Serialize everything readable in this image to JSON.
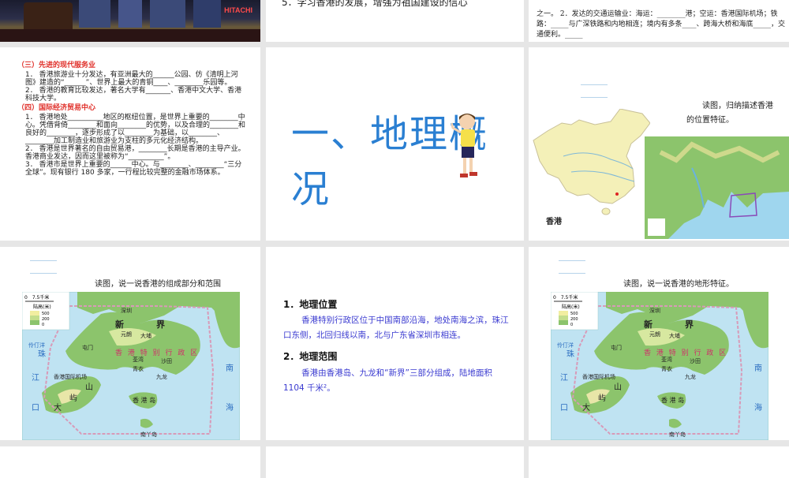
{
  "slide1": {
    "photo_sign": "HITACHI"
  },
  "slide2": {
    "text": "5．学习香港的发展，增强为祖国建设的信心"
  },
  "slide3": {
    "text": "之一。 2．发达的交通运输业：海运：________港；空运：香港国际机场；铁路：_____与广深铁路和内地相连；境内有多条____、跨海大桥和海底_____，交通便利。_____"
  },
  "slide4": {
    "h1": "（三）先进的现代服务业",
    "p1": "1． 香港旅游业十分发达，有亚洲最大的______公园、仿《清明上河图》建造的“______”、世界上最大的青铜____、________乐园等。",
    "p2": "2． 香港的教育比较发达，著名大学有_______、香港中文大学、香港科技大学。",
    "h2": "（四）国际经济贸易中心",
    "p3": "1． 香港地处__________地区的枢纽位置，是世界上重要的________中心。凭借背倚________和面向________的优势，以及合理的________和良好的________，逐步形成了以________为基础，以________、________加工制造业和旅游业为支柱的多元化经济结构。",
    "p4": "2． 香港是世界著名的自由贸易港，________长期是香港的主导产业。香港商业发达，因而这里被称为“__________”。",
    "p5": "3． 香港市是世界上重要的______中心。与________、________“三分全球”。现有银行 180 多家，一行程比较完整的金融市场体系。"
  },
  "slide5": {
    "title": "一、地理概况"
  },
  "slide6": {
    "caption": "读图，归纳描述香港的位置特征。",
    "hk_label": "香港"
  },
  "slide7": {
    "caption": "读图，说一说香港的组成部分和范围"
  },
  "slide8": {
    "h1": "1．地理位置",
    "p1": "香港特别行政区位于中国南部沿海，地处南海之滨，珠江口东侧，北回归线以南，北与广东省深圳市相连。",
    "h2": "2．地理范围",
    "p2": "香港由香港岛、九龙和“新界”三部分组成，陆地面积 1104 千米²。"
  },
  "slide9": {
    "caption": "读图，说一说香港的地形特征。"
  },
  "hkmap": {
    "scale": "0　7.5千米",
    "legend_title": "陆高(米)",
    "legend": [
      "500",
      "200",
      "0"
    ],
    "labels": {
      "xinjie1": "新",
      "xinjie2": "界",
      "sar": "香 港 特 别 行 政 区",
      "shenzhen": "深圳",
      "yuenlong": "元朗",
      "taipo": "大埔",
      "tuenmun": "屯门",
      "tsuenwan": "荃湾",
      "shatin": "沙田",
      "kowloon": "九龙",
      "hkisland": "香 港 岛",
      "lantau1": "大",
      "lantau2": "屿",
      "lantau3": "山",
      "airport": "香港国际机场",
      "lamma": "南丫岛",
      "tsingyi": "青衣",
      "sea1": "南",
      "sea2": "海",
      "pearl1": "珠",
      "pearl2": "江",
      "pearl3": "口",
      "lingding": "伶仃洋"
    }
  },
  "colors": {
    "title_blue": "#2a7fd2",
    "body_blue": "#3a3ad0",
    "heading_red": "#e0302a",
    "sea": "#bfe3f2",
    "land": "#8cc46c"
  }
}
